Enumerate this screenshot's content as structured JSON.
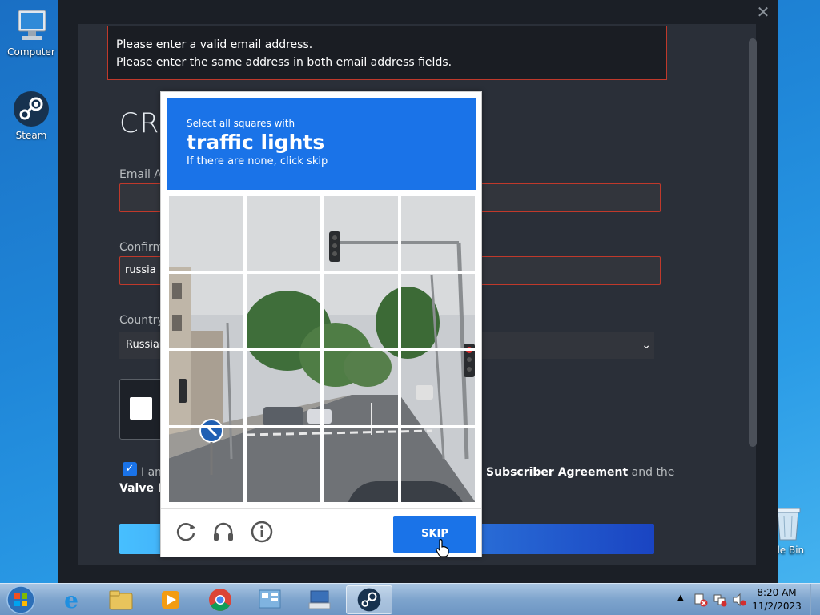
{
  "desktop": {
    "icons": [
      {
        "label": "Computer"
      },
      {
        "label": "Steam"
      },
      {
        "label": "cle Bin"
      }
    ]
  },
  "steam": {
    "errors": [
      "Please enter a valid email address.",
      "Please enter the same address in both email address fields."
    ],
    "heading": "CR",
    "email_label": "Email A",
    "email_value": "",
    "confirm_label": "Confirm",
    "confirm_value": "russia",
    "country_label": "Country",
    "country_value": "Russian",
    "agree_text_start": "I am",
    "agree_link_mid": "Subscriber Agreement",
    "agree_text_end": " and the",
    "agree_link_2": "Valve Pr",
    "agree_checked": true
  },
  "captcha": {
    "instruction_small": "Select all squares with",
    "target": "traffic lights",
    "hint": "If there are none, click skip",
    "grid_size": 4,
    "skip_label": "SKIP",
    "icons": [
      "reload-icon",
      "audio-icon",
      "info-icon"
    ],
    "accent": "#1a73e8"
  },
  "taskbar": {
    "time": "8:20 AM",
    "date": "11/2/2023",
    "pinned": [
      "internet-explorer",
      "file-explorer",
      "media-player",
      "chrome",
      "control-panel",
      "keyboard",
      "steam"
    ],
    "active": "steam"
  }
}
